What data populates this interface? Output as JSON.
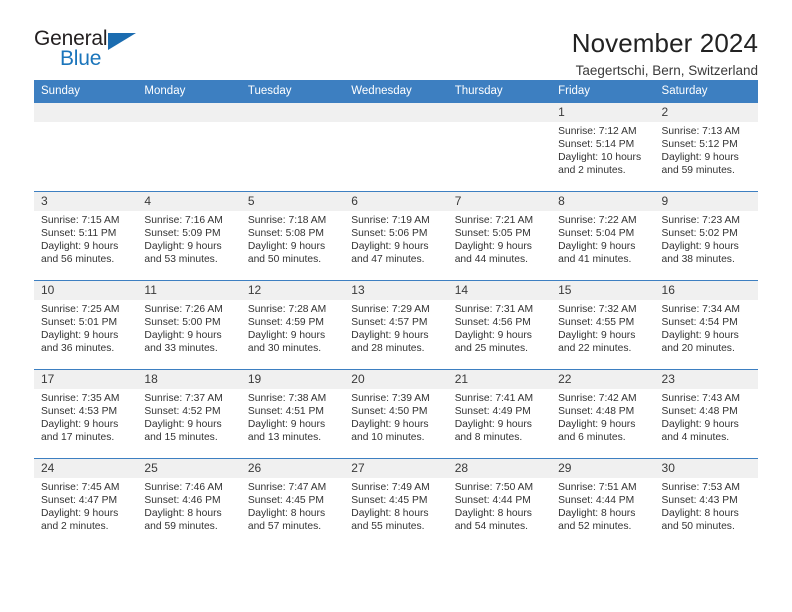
{
  "brand": {
    "word_one": "General",
    "word_two": "Blue",
    "logo_icon": "triangle-logo-icon",
    "accent_color": "#1b75bb"
  },
  "header": {
    "title": "November 2024",
    "subtitle": "Taegertschi, Bern, Switzerland"
  },
  "theme": {
    "header_blue": "#3d7fc1",
    "daynum_gray": "#f0f0f0",
    "text": "#333333"
  },
  "labels": {
    "sunrise_prefix": "Sunrise:",
    "sunset_prefix": "Sunset:",
    "daylight_prefix": "Daylight:"
  },
  "weekdays": [
    "Sunday",
    "Monday",
    "Tuesday",
    "Wednesday",
    "Thursday",
    "Friday",
    "Saturday"
  ],
  "weeks": [
    [
      {
        "day": ""
      },
      {
        "day": ""
      },
      {
        "day": ""
      },
      {
        "day": ""
      },
      {
        "day": ""
      },
      {
        "day": "1",
        "sunrise": "Sunrise: 7:12 AM",
        "sunset": "Sunset: 5:14 PM",
        "daylight_1": "Daylight: 10 hours",
        "daylight_2": "and 2 minutes."
      },
      {
        "day": "2",
        "sunrise": "Sunrise: 7:13 AM",
        "sunset": "Sunset: 5:12 PM",
        "daylight_1": "Daylight: 9 hours",
        "daylight_2": "and 59 minutes."
      }
    ],
    [
      {
        "day": "3",
        "sunrise": "Sunrise: 7:15 AM",
        "sunset": "Sunset: 5:11 PM",
        "daylight_1": "Daylight: 9 hours",
        "daylight_2": "and 56 minutes."
      },
      {
        "day": "4",
        "sunrise": "Sunrise: 7:16 AM",
        "sunset": "Sunset: 5:09 PM",
        "daylight_1": "Daylight: 9 hours",
        "daylight_2": "and 53 minutes."
      },
      {
        "day": "5",
        "sunrise": "Sunrise: 7:18 AM",
        "sunset": "Sunset: 5:08 PM",
        "daylight_1": "Daylight: 9 hours",
        "daylight_2": "and 50 minutes."
      },
      {
        "day": "6",
        "sunrise": "Sunrise: 7:19 AM",
        "sunset": "Sunset: 5:06 PM",
        "daylight_1": "Daylight: 9 hours",
        "daylight_2": "and 47 minutes."
      },
      {
        "day": "7",
        "sunrise": "Sunrise: 7:21 AM",
        "sunset": "Sunset: 5:05 PM",
        "daylight_1": "Daylight: 9 hours",
        "daylight_2": "and 44 minutes."
      },
      {
        "day": "8",
        "sunrise": "Sunrise: 7:22 AM",
        "sunset": "Sunset: 5:04 PM",
        "daylight_1": "Daylight: 9 hours",
        "daylight_2": "and 41 minutes."
      },
      {
        "day": "9",
        "sunrise": "Sunrise: 7:23 AM",
        "sunset": "Sunset: 5:02 PM",
        "daylight_1": "Daylight: 9 hours",
        "daylight_2": "and 38 minutes."
      }
    ],
    [
      {
        "day": "10",
        "sunrise": "Sunrise: 7:25 AM",
        "sunset": "Sunset: 5:01 PM",
        "daylight_1": "Daylight: 9 hours",
        "daylight_2": "and 36 minutes."
      },
      {
        "day": "11",
        "sunrise": "Sunrise: 7:26 AM",
        "sunset": "Sunset: 5:00 PM",
        "daylight_1": "Daylight: 9 hours",
        "daylight_2": "and 33 minutes."
      },
      {
        "day": "12",
        "sunrise": "Sunrise: 7:28 AM",
        "sunset": "Sunset: 4:59 PM",
        "daylight_1": "Daylight: 9 hours",
        "daylight_2": "and 30 minutes."
      },
      {
        "day": "13",
        "sunrise": "Sunrise: 7:29 AM",
        "sunset": "Sunset: 4:57 PM",
        "daylight_1": "Daylight: 9 hours",
        "daylight_2": "and 28 minutes."
      },
      {
        "day": "14",
        "sunrise": "Sunrise: 7:31 AM",
        "sunset": "Sunset: 4:56 PM",
        "daylight_1": "Daylight: 9 hours",
        "daylight_2": "and 25 minutes."
      },
      {
        "day": "15",
        "sunrise": "Sunrise: 7:32 AM",
        "sunset": "Sunset: 4:55 PM",
        "daylight_1": "Daylight: 9 hours",
        "daylight_2": "and 22 minutes."
      },
      {
        "day": "16",
        "sunrise": "Sunrise: 7:34 AM",
        "sunset": "Sunset: 4:54 PM",
        "daylight_1": "Daylight: 9 hours",
        "daylight_2": "and 20 minutes."
      }
    ],
    [
      {
        "day": "17",
        "sunrise": "Sunrise: 7:35 AM",
        "sunset": "Sunset: 4:53 PM",
        "daylight_1": "Daylight: 9 hours",
        "daylight_2": "and 17 minutes."
      },
      {
        "day": "18",
        "sunrise": "Sunrise: 7:37 AM",
        "sunset": "Sunset: 4:52 PM",
        "daylight_1": "Daylight: 9 hours",
        "daylight_2": "and 15 minutes."
      },
      {
        "day": "19",
        "sunrise": "Sunrise: 7:38 AM",
        "sunset": "Sunset: 4:51 PM",
        "daylight_1": "Daylight: 9 hours",
        "daylight_2": "and 13 minutes."
      },
      {
        "day": "20",
        "sunrise": "Sunrise: 7:39 AM",
        "sunset": "Sunset: 4:50 PM",
        "daylight_1": "Daylight: 9 hours",
        "daylight_2": "and 10 minutes."
      },
      {
        "day": "21",
        "sunrise": "Sunrise: 7:41 AM",
        "sunset": "Sunset: 4:49 PM",
        "daylight_1": "Daylight: 9 hours",
        "daylight_2": "and 8 minutes."
      },
      {
        "day": "22",
        "sunrise": "Sunrise: 7:42 AM",
        "sunset": "Sunset: 4:48 PM",
        "daylight_1": "Daylight: 9 hours",
        "daylight_2": "and 6 minutes."
      },
      {
        "day": "23",
        "sunrise": "Sunrise: 7:43 AM",
        "sunset": "Sunset: 4:48 PM",
        "daylight_1": "Daylight: 9 hours",
        "daylight_2": "and 4 minutes."
      }
    ],
    [
      {
        "day": "24",
        "sunrise": "Sunrise: 7:45 AM",
        "sunset": "Sunset: 4:47 PM",
        "daylight_1": "Daylight: 9 hours",
        "daylight_2": "and 2 minutes."
      },
      {
        "day": "25",
        "sunrise": "Sunrise: 7:46 AM",
        "sunset": "Sunset: 4:46 PM",
        "daylight_1": "Daylight: 8 hours",
        "daylight_2": "and 59 minutes."
      },
      {
        "day": "26",
        "sunrise": "Sunrise: 7:47 AM",
        "sunset": "Sunset: 4:45 PM",
        "daylight_1": "Daylight: 8 hours",
        "daylight_2": "and 57 minutes."
      },
      {
        "day": "27",
        "sunrise": "Sunrise: 7:49 AM",
        "sunset": "Sunset: 4:45 PM",
        "daylight_1": "Daylight: 8 hours",
        "daylight_2": "and 55 minutes."
      },
      {
        "day": "28",
        "sunrise": "Sunrise: 7:50 AM",
        "sunset": "Sunset: 4:44 PM",
        "daylight_1": "Daylight: 8 hours",
        "daylight_2": "and 54 minutes."
      },
      {
        "day": "29",
        "sunrise": "Sunrise: 7:51 AM",
        "sunset": "Sunset: 4:44 PM",
        "daylight_1": "Daylight: 8 hours",
        "daylight_2": "and 52 minutes."
      },
      {
        "day": "30",
        "sunrise": "Sunrise: 7:53 AM",
        "sunset": "Sunset: 4:43 PM",
        "daylight_1": "Daylight: 8 hours",
        "daylight_2": "and 50 minutes."
      }
    ]
  ]
}
